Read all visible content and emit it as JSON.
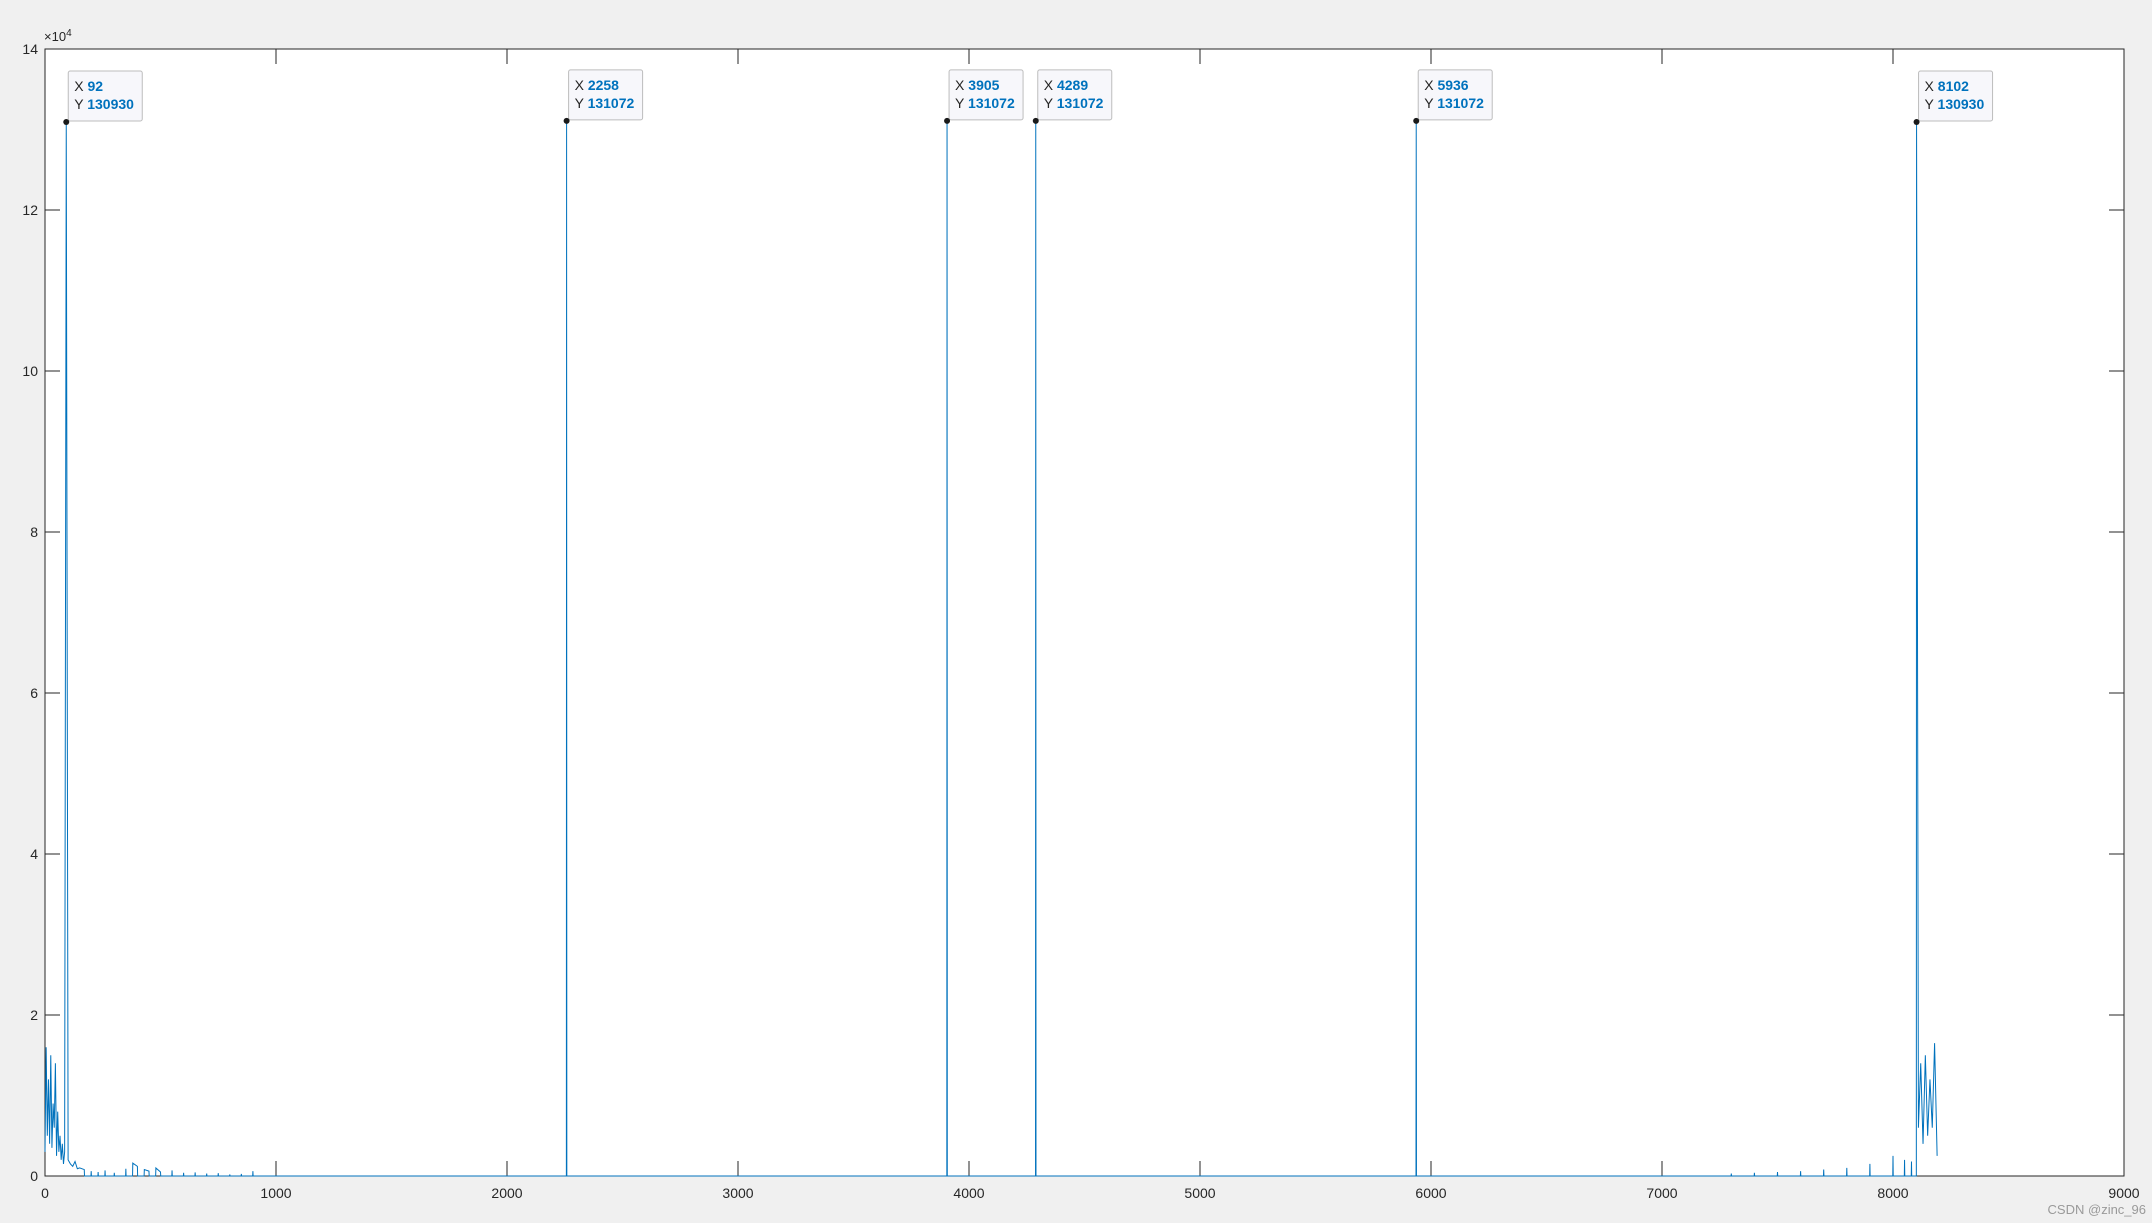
{
  "chart_data": {
    "type": "line",
    "title": "",
    "xlabel": "",
    "ylabel": "",
    "xlim": [
      0,
      9000
    ],
    "ylim": [
      0,
      140000
    ],
    "x_ticks": [
      0,
      1000,
      2000,
      3000,
      4000,
      5000,
      6000,
      7000,
      8000,
      9000
    ],
    "x_tick_labels": [
      "0",
      "1000",
      "2000",
      "3000",
      "4000",
      "5000",
      "6000",
      "7000",
      "8000",
      "9000"
    ],
    "y_ticks": [
      0,
      20000,
      40000,
      60000,
      80000,
      100000,
      120000,
      140000
    ],
    "y_tick_labels": [
      "0",
      "2",
      "4",
      "6",
      "8",
      "10",
      "12",
      "14"
    ],
    "y_exponent_base": "×10",
    "y_exponent_power": "4",
    "grid": false,
    "line_color": "#0072bd",
    "n_points": 8192,
    "series": [
      {
        "name": "",
        "x": [
          0,
          5,
          10,
          15,
          20,
          25,
          30,
          35,
          40,
          45,
          50,
          55,
          60,
          65,
          70,
          75,
          80,
          85,
          92,
          100,
          110,
          120,
          130,
          140,
          150,
          170,
          200,
          230,
          260,
          300,
          350,
          380,
          400,
          430,
          450,
          480,
          500,
          550,
          600,
          650,
          700,
          750,
          800,
          850,
          900,
          2258,
          3905,
          4289,
          5936,
          7300,
          7400,
          7500,
          7600,
          7700,
          7800,
          7900,
          8000,
          8050,
          8080,
          8102,
          8110,
          8120,
          8130,
          8140,
          8150,
          8160,
          8170,
          8180,
          8191
        ],
        "y": [
          3000,
          16000,
          5000,
          12000,
          4000,
          15000,
          3500,
          9000,
          6000,
          14000,
          2500,
          8000,
          3000,
          5000,
          2000,
          4000,
          1500,
          3000,
          130930,
          2000,
          1500,
          1200,
          1800,
          900,
          1000,
          800,
          600,
          500,
          700,
          400,
          900,
          1600,
          1200,
          800,
          600,
          1000,
          500,
          700,
          400,
          450,
          300,
          350,
          200,
          250,
          600,
          131072,
          131072,
          131072,
          131072,
          300,
          400,
          500,
          600,
          800,
          1000,
          1500,
          2500,
          2000,
          1800,
          130930,
          6000,
          14000,
          4000,
          15000,
          5000,
          12000,
          6000,
          16500,
          2500
        ]
      }
    ],
    "datatips": [
      {
        "x_key": "X",
        "x_value": "92",
        "y_key": "Y",
        "y_value": "130930",
        "x": 92,
        "y": 130930
      },
      {
        "x_key": "X",
        "x_value": "2258",
        "y_key": "Y",
        "y_value": "131072",
        "x": 2258,
        "y": 131072
      },
      {
        "x_key": "X",
        "x_value": "3905",
        "y_key": "Y",
        "y_value": "131072",
        "x": 3905,
        "y": 131072
      },
      {
        "x_key": "X",
        "x_value": "4289",
        "y_key": "Y",
        "y_value": "131072",
        "x": 4289,
        "y": 131072
      },
      {
        "x_key": "X",
        "x_value": "5936",
        "y_key": "Y",
        "y_value": "131072",
        "x": 5936,
        "y": 131072
      },
      {
        "x_key": "X",
        "x_value": "8102",
        "y_key": "Y",
        "y_value": "130930",
        "x": 8102,
        "y": 130930
      }
    ]
  },
  "watermark": "CSDN @zinc_96"
}
